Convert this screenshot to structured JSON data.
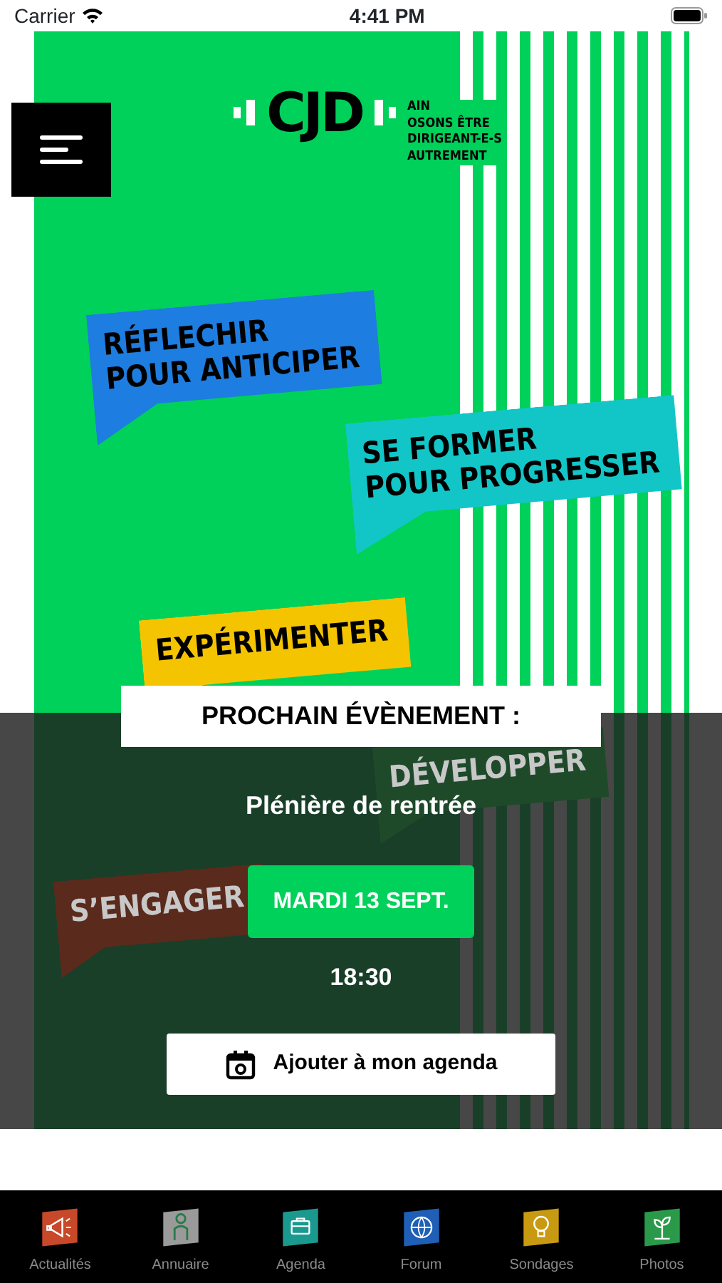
{
  "status_bar": {
    "carrier": "Carrier",
    "time": "4:41 PM"
  },
  "logo": {
    "mark": "CJD",
    "tagline": [
      "AIN",
      "OSONS ÊTRE",
      "DIRIGEANT-E-S",
      "AUTREMENT"
    ]
  },
  "banners": [
    {
      "lines": [
        "RÉFLECHIR",
        "POUR ANTICIPER"
      ],
      "color": "#1e7de0"
    },
    {
      "lines": [
        "SE FORMER",
        "POUR PROGRESSER"
      ],
      "color": "#12c6c8"
    },
    {
      "lines": [
        "EXPÉRIMENTER"
      ],
      "color": "#f5c400"
    },
    {
      "lines": [
        "DÉVELOPPER"
      ],
      "color": "#1e4a2a"
    },
    {
      "lines": [
        "S’ENGAGER"
      ],
      "color": "#5a2a1c"
    }
  ],
  "event": {
    "heading": "PROCHAIN ÉVÈNEMENT :",
    "name": "Plénière de rentrée",
    "date": "MARDI 13 SEPT.",
    "time": "18:30",
    "add_button": "Ajouter à mon agenda"
  },
  "tabs": [
    {
      "label": "Actualités",
      "color": "#c8482a"
    },
    {
      "label": "Annuaire",
      "color": "#9a9a9a"
    },
    {
      "label": "Agenda",
      "color": "#1a9a8f"
    },
    {
      "label": "Forum",
      "color": "#1f5fb5"
    },
    {
      "label": "Sondages",
      "color": "#c79a12"
    },
    {
      "label": "Photos",
      "color": "#2a9a4a"
    }
  ]
}
